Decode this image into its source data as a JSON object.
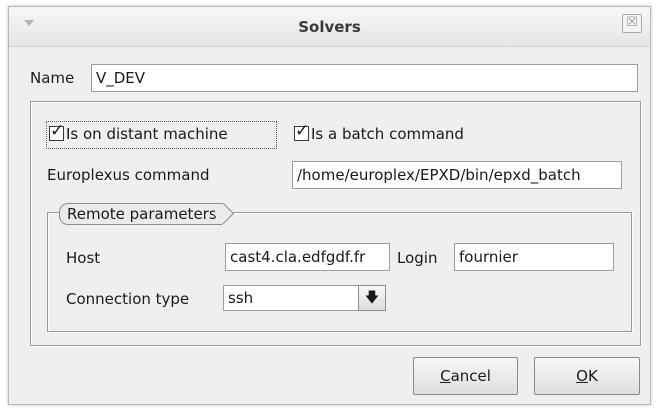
{
  "window": {
    "title": "Solvers",
    "menu_icon": "chevron-down-icon",
    "close_icon": "close-icon",
    "close_glyph": "☒"
  },
  "name": {
    "label": "Name",
    "value": "V_DEV"
  },
  "options": {
    "distant_machine_label": "Is on distant machine",
    "distant_machine_checked": true,
    "batch_command_label": "Is a batch command",
    "batch_command_checked": true,
    "check_glyph": "✓"
  },
  "command": {
    "label": "Europlexus command",
    "value": "/home/europlex/EPXD/bin/epxd_batch"
  },
  "remote": {
    "group_label": "Remote parameters",
    "host_label": "Host",
    "host_value": "cast4.cla.edfgdf.fr",
    "login_label": "Login",
    "login_value": "fournier",
    "connection_label": "Connection type",
    "connection_value": "ssh",
    "dropdown_icon": "arrow-down-icon",
    "dropdown_glyph": "🡇"
  },
  "buttons": {
    "cancel_label": "Cancel",
    "ok_label": "OK"
  }
}
